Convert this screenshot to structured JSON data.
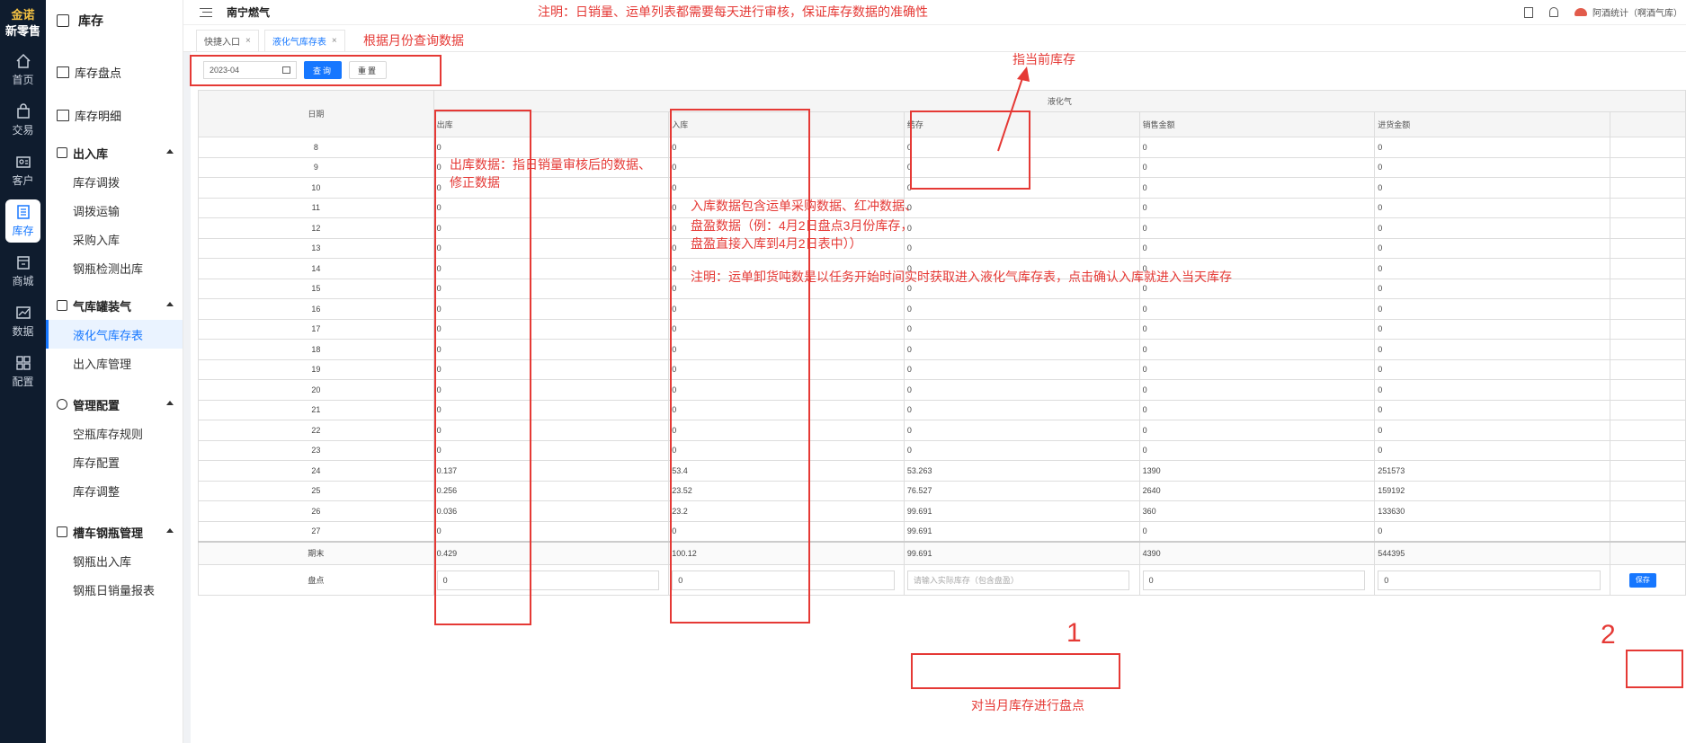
{
  "brand": {
    "line1": "金诺",
    "line2": "新零售"
  },
  "rail": [
    {
      "label": "首页",
      "icon": "home-icon"
    },
    {
      "label": "交易",
      "icon": "bag-icon"
    },
    {
      "label": "客户",
      "icon": "id-card-icon"
    },
    {
      "label": "库存",
      "icon": "inventory-icon"
    },
    {
      "label": "商城",
      "icon": "store-icon"
    },
    {
      "label": "数据",
      "icon": "chart-icon"
    },
    {
      "label": "配置",
      "icon": "grid-icon"
    }
  ],
  "sidebar": {
    "title": "库存",
    "top_items": [
      "库存盘点",
      "库存明细"
    ],
    "groups": [
      {
        "label": "出入库",
        "items": [
          "库存调拨",
          "调拨运输",
          "采购入库",
          "钢瓶检测出库"
        ]
      },
      {
        "label": "气库罐装气",
        "items": [
          "液化气库存表",
          "出入库管理"
        ]
      },
      {
        "label": "管理配置",
        "items": [
          "空瓶库存规则",
          "库存配置",
          "库存调整"
        ]
      },
      {
        "label": "槽车钢瓶管理",
        "items": [
          "钢瓶出入库",
          "钢瓶日销量报表"
        ]
      }
    ]
  },
  "header": {
    "company": "南宁燃气",
    "user": "阿酒统计（啊酒气库）"
  },
  "tabs": [
    "快捷入口",
    "液化气库存表"
  ],
  "filters": {
    "month": "2023-04",
    "query_label": "查询",
    "reset_label": "重置"
  },
  "table": {
    "date_header": "日期",
    "group_header": "液化气",
    "columns": [
      "出库",
      "入库",
      "结存",
      "销售金额",
      "进货金额"
    ],
    "rows": [
      [
        "8",
        "0",
        "0",
        "0",
        "0",
        "0"
      ],
      [
        "9",
        "0",
        "0",
        "0",
        "0",
        "0"
      ],
      [
        "10",
        "0",
        "0",
        "0",
        "0",
        "0"
      ],
      [
        "11",
        "0",
        "0",
        "0",
        "0",
        "0"
      ],
      [
        "12",
        "0",
        "0",
        "0",
        "0",
        "0"
      ],
      [
        "13",
        "0",
        "0",
        "0",
        "0",
        "0"
      ],
      [
        "14",
        "0",
        "0",
        "0",
        "0",
        "0"
      ],
      [
        "15",
        "0",
        "0",
        "0",
        "0",
        "0"
      ],
      [
        "16",
        "0",
        "0",
        "0",
        "0",
        "0"
      ],
      [
        "17",
        "0",
        "0",
        "0",
        "0",
        "0"
      ],
      [
        "18",
        "0",
        "0",
        "0",
        "0",
        "0"
      ],
      [
        "19",
        "0",
        "0",
        "0",
        "0",
        "0"
      ],
      [
        "20",
        "0",
        "0",
        "0",
        "0",
        "0"
      ],
      [
        "21",
        "0",
        "0",
        "0",
        "0",
        "0"
      ],
      [
        "22",
        "0",
        "0",
        "0",
        "0",
        "0"
      ],
      [
        "23",
        "0",
        "0",
        "0",
        "0",
        "0"
      ],
      [
        "24",
        "0.137",
        "53.4",
        "53.263",
        "1390",
        "251573"
      ],
      [
        "25",
        "0.256",
        "23.52",
        "76.527",
        "2640",
        "159192"
      ],
      [
        "26",
        "0.036",
        "23.2",
        "99.691",
        "360",
        "133630"
      ],
      [
        "27",
        "0",
        "0",
        "99.691",
        "0",
        "0"
      ]
    ],
    "end_row": {
      "label": "期末",
      "values": [
        "0.429",
        "100.12",
        "99.691",
        "4390",
        "544395"
      ]
    },
    "inventory_row": {
      "label": "盘点",
      "out_value": "0",
      "in_value": "0",
      "actual_placeholder": "请输入实际库存（包含盘盈）",
      "sales_value": "0",
      "purchase_value": "0",
      "save_label": "保存"
    }
  },
  "annotations": {
    "top_note": "注明：日销量、运单列表都需要每天进行审核，保证库存数据的准确性",
    "month_query": "根据月份查询数据",
    "current_stock": "指当前库存",
    "out_note": [
      "出库数据：指日销量审核后的数据、",
      "修正数据"
    ],
    "in_note": [
      "入库数据包含运单采购数据、红冲数据、",
      "盘盈数据（例：4月2日盘点3月份库存，",
      "盘盈直接入库到4月2日表中））"
    ],
    "waybill_note": "注明：运单卸货吨数是以任务开始时间实时获取进入液化气库存表，点击确认入库就进入当天库存",
    "inventory_note": "对当月库存进行盘点",
    "num1": "1",
    "num2": "2"
  }
}
